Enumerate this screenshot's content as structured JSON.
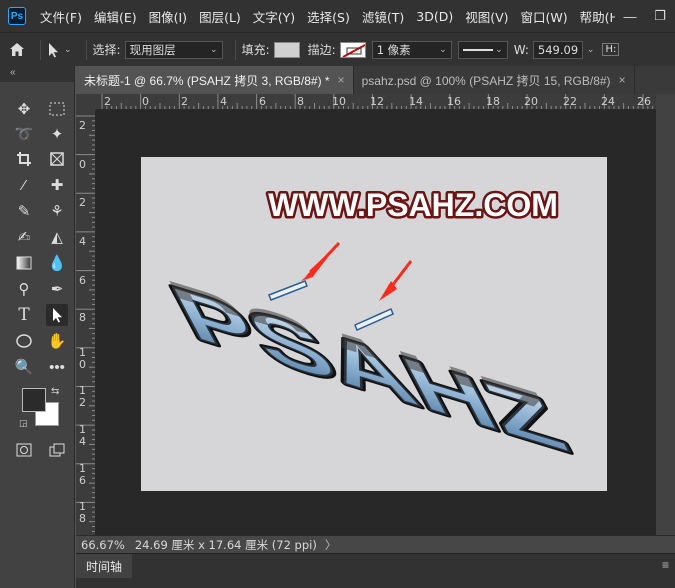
{
  "menubar": {
    "logo": "Ps",
    "items": [
      "文件(F)",
      "编辑(E)",
      "图像(I)",
      "图层(L)",
      "文字(Y)",
      "选择(S)",
      "滤镜(T)",
      "3D(D)",
      "视图(V)",
      "窗口(W)",
      "帮助(H)"
    ],
    "window_controls": [
      "minimize-icon",
      "restore-icon"
    ]
  },
  "options": {
    "select_label": "选择:",
    "select_value": "现用图层",
    "fill_label": "填充:",
    "stroke_label": "描边:",
    "stroke_width": "1 像素",
    "width_label": "W:",
    "width_value": "549.09",
    "link_label": "H:"
  },
  "tabs": [
    {
      "label": "未标题-1 @ 66.7% (PSAHZ 拷贝 3, RGB/8#) *",
      "active": true
    },
    {
      "label": "psahz.psd @ 100% (PSAHZ 拷贝 15, RGB/8#)",
      "active": false
    }
  ],
  "ruler_top": [
    "2",
    "0",
    "2",
    "4",
    "6",
    "8",
    "10",
    "12",
    "14",
    "16",
    "18",
    "20",
    "22",
    "24",
    "26"
  ],
  "ruler_left": [
    "2",
    "0",
    "2",
    "4",
    "6",
    "8",
    "1",
    "0",
    "1",
    "2",
    "1",
    "4",
    "1",
    "6",
    "1",
    "8"
  ],
  "canvas": {
    "headline": "WWW.PSAHZ.COM",
    "cut_text": "PSAHZ",
    "colors": {
      "background": "#d6d6d8",
      "headline_fill": "#ffffff",
      "headline_stroke": "#6b1414",
      "hole_fill": "#7ea5c8",
      "arrow": "#ff2a1a"
    }
  },
  "status": {
    "zoom": "66.67%",
    "doc_size": "24.69 厘米 x 17.64 厘米 (72 ppi)",
    "more": "〉"
  },
  "timeline": {
    "label": "时间轴"
  },
  "colors": {
    "foreground": "#2b2b2b",
    "background": "#ffffff"
  }
}
